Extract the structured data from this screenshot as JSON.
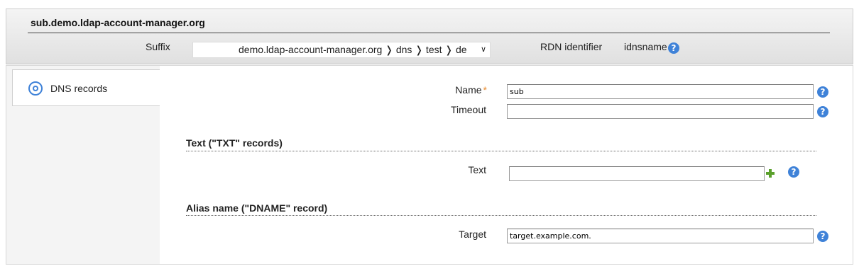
{
  "header": {
    "title": "sub.demo.ldap-account-manager.org",
    "suffix_label": "Suffix",
    "suffix_value": "demo.ldap-account-manager.org ❭ dns ❭ test ❭ de",
    "rdn_label": "RDN identifier",
    "rdn_value": "idnsname"
  },
  "sidebar": {
    "tabs": [
      {
        "label": "DNS records",
        "icon": "dns-icon"
      }
    ]
  },
  "form": {
    "name": {
      "label": "Name",
      "required_mark": "*",
      "value": "sub"
    },
    "timeout": {
      "label": "Timeout",
      "value": ""
    },
    "txt_section": {
      "title": "Text (\"TXT\" records)"
    },
    "text": {
      "label": "Text",
      "value": ""
    },
    "dname_section": {
      "title": "Alias name (\"DNAME\" record)"
    },
    "target": {
      "label": "Target",
      "value": "target.example.com."
    }
  },
  "icons": {
    "help": "?",
    "help_color": "#3f82d8",
    "add_color": "#5aa02c"
  }
}
